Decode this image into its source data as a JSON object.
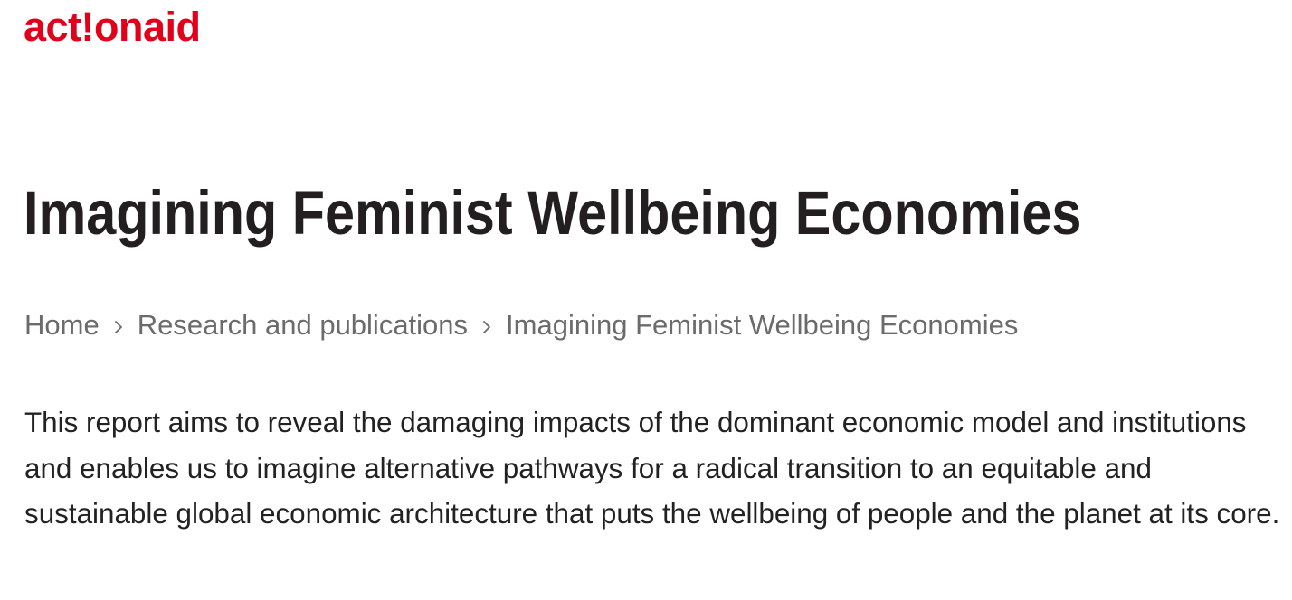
{
  "header": {
    "logo_text": "act!onaid"
  },
  "brand_colors": {
    "accent": "#e3001b",
    "title": "#231f20",
    "breadcrumb": "#6b6b6b",
    "body_text": "#222222"
  },
  "main": {
    "title": "Imagining Feminist Wellbeing Economies",
    "breadcrumb": {
      "items": [
        {
          "label": "Home"
        },
        {
          "label": "Research and publications"
        },
        {
          "label": "Imagining Feminist Wellbeing Economies"
        }
      ],
      "separator_icon": "chevron-right-icon"
    },
    "intro": "This report aims to reveal the damaging impacts of the dominant economic model and institutions and enables us to imagine alternative pathways for a radical transition to an equitable and sustainable global economic architecture that puts the wellbeing of people and the planet at its core."
  }
}
